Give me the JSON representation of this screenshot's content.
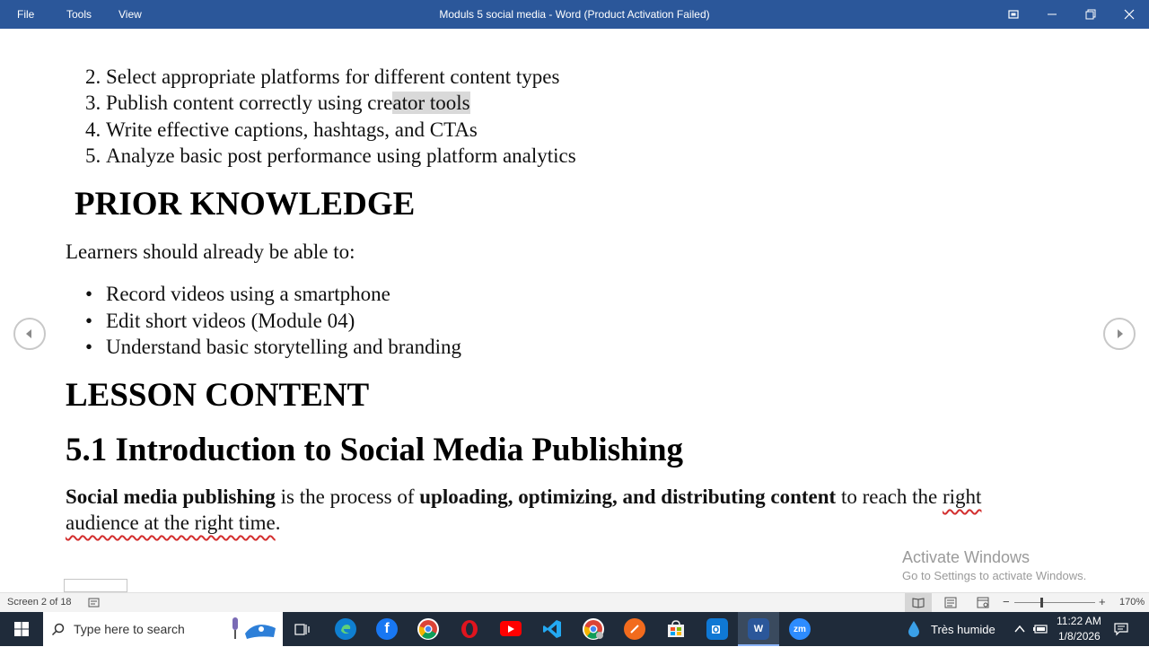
{
  "titlebar": {
    "menu": [
      "File",
      "Tools",
      "View"
    ],
    "title": "Moduls 5 social media - Word (Product Activation Failed)"
  },
  "document": {
    "objectives": [
      {
        "num": "2.",
        "text": "Select appropriate platforms for different content types"
      },
      {
        "num": "3.",
        "text_before": "Publish content correctly using cre",
        "text_highlight": "ator tools"
      },
      {
        "num": "4.",
        "text": "Write effective captions, hashtags, and CTAs"
      },
      {
        "num": "5.",
        "text": "Analyze basic post performance using platform analytics"
      }
    ],
    "prior_heading": "PRIOR KNOWLEDGE",
    "prior_intro": "Learners should already be able to:",
    "prior_items": [
      "Record videos using a smartphone",
      "Edit short videos (Module 04)",
      "Understand basic storytelling and branding"
    ],
    "lesson_heading": "LESSON CONTENT",
    "section_heading": "5.1 Introduction to Social Media Publishing",
    "definition": {
      "b1": "Social media publishing",
      "t1": " is the process of ",
      "b2": "uploading, optimizing, and distributing content",
      "t2": " to reach the ",
      "u1": "right",
      "line2": "audience at the right time",
      "end": "."
    },
    "bullet_glyph": "•"
  },
  "watermark": {
    "title": "Activate Windows",
    "subtitle": "Go to Settings to activate Windows."
  },
  "statusbar": {
    "screen": "Screen 2 of 18",
    "zoom": "170%",
    "zoom_level_percent": 170
  },
  "taskbar": {
    "search_placeholder": "Type here to search",
    "weather": "Très humide",
    "time": "11:22 AM",
    "date": "1/8/2026",
    "apps": [
      "edge-icon",
      "facebook-icon",
      "chrome-icon",
      "opera-icon",
      "youtube-icon",
      "vscode-icon",
      "chrome-profile-icon",
      "app-orange-icon",
      "store-icon",
      "outlook-icon",
      "word-icon",
      "zoom-icon"
    ]
  },
  "colors": {
    "titlebar": "#2b579a",
    "taskbar": "#1f2b3a",
    "spell_underline": "#d32f2f",
    "highlight": "#d9d9d9"
  }
}
